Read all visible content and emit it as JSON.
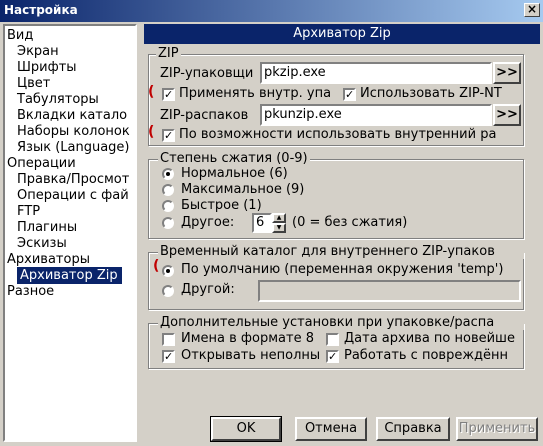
{
  "window": {
    "title": "Настройка",
    "close_symbol": "×"
  },
  "tree": {
    "items": [
      {
        "label": "Вид",
        "level": 0
      },
      {
        "label": "Экран",
        "level": 1
      },
      {
        "label": "Шрифты",
        "level": 1
      },
      {
        "label": "Цвет",
        "level": 1
      },
      {
        "label": "Табуляторы",
        "level": 1
      },
      {
        "label": "Вкладки катало",
        "level": 1
      },
      {
        "label": "Наборы колонок",
        "level": 1
      },
      {
        "label": "Язык (Language)",
        "level": 1
      },
      {
        "label": "Операции",
        "level": 0
      },
      {
        "label": "Правка/Просмот",
        "level": 1
      },
      {
        "label": "Операции с фай",
        "level": 1
      },
      {
        "label": "FTP",
        "level": 1
      },
      {
        "label": "Плагины",
        "level": 1
      },
      {
        "label": "Эскизы",
        "level": 1
      },
      {
        "label": "Архиваторы",
        "level": 0
      },
      {
        "label": "Архиватор Zip",
        "level": 1,
        "selected": true
      },
      {
        "label": "Разное",
        "level": 0
      }
    ]
  },
  "panel_title": "Архиватор Zip",
  "zip_group": {
    "legend": "ZIP",
    "packer_label": "ZIP-упаковщи",
    "packer_value": "pkzip.exe",
    "browse_label": ">>",
    "use_internal_label": "Применять внутр. упа",
    "use_internal_checked": true,
    "use_zipnt_label": "Использовать ZIP-NT",
    "use_zipnt_checked": true,
    "unpacker_label": "ZIP-распаков",
    "unpacker_value": "pkunzip.exe",
    "use_internal_unpack_label": "По возможности использовать внутренний ра",
    "use_internal_unpack_checked": true
  },
  "compression_group": {
    "legend": "Степень сжатия (0-9)",
    "options": [
      {
        "label": "Нормальное (6)",
        "checked": true
      },
      {
        "label": "Максимальное (9)",
        "checked": false
      },
      {
        "label": "Быстрое (1)",
        "checked": false
      },
      {
        "label": "Другое:",
        "checked": false
      }
    ],
    "other_value": "6",
    "other_hint": "(0 = без сжатия)"
  },
  "tempdir_group": {
    "legend": "Временный каталог для внутреннего ZIP-упаков",
    "default_label": "По умолчанию (переменная окружения 'temp')",
    "default_checked": true,
    "other_label": "Другой:",
    "other_value": ""
  },
  "extra_group": {
    "legend": "Дополнительные установки при упаковке/распа",
    "names83_label": "Имена в формате 8",
    "names83_checked": false,
    "archive_date_label": "Дата архива по новейше",
    "archive_date_checked": false,
    "open_incomplete_label": "Открывать неполны",
    "open_incomplete_checked": true,
    "damaged_label": "Работать с повреждённ",
    "damaged_checked": true
  },
  "buttons": {
    "ok": "OK",
    "cancel": "Отмена",
    "help": "Справка",
    "apply": "Применить"
  },
  "colors": {
    "title_start": "#0a246a",
    "title_end": "#a6caf0",
    "selection": "#0a246a",
    "annotation": "#c00000"
  }
}
